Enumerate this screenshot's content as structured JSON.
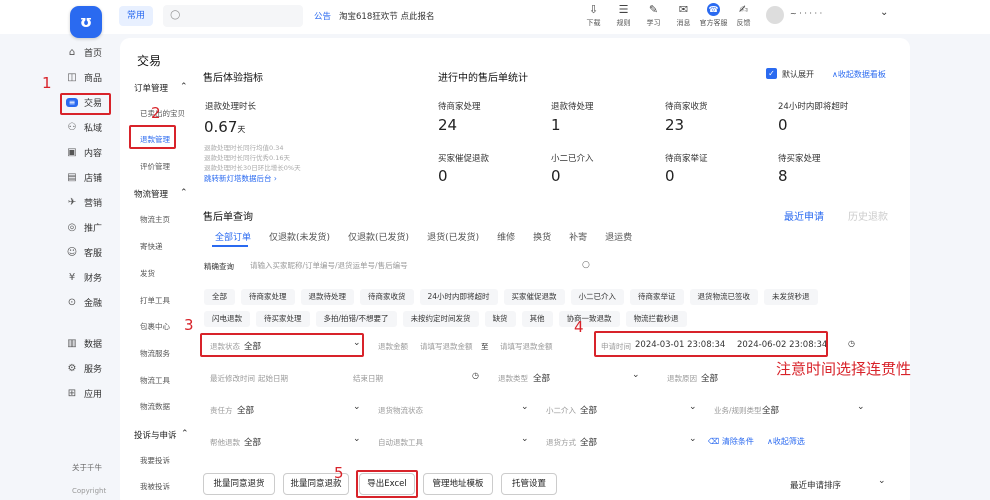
{
  "topbar": {
    "logo": "ʊ",
    "freq": "常用",
    "notice_tag": "公告",
    "notice_text": "淘宝618狂欢节 点此报名",
    "tools": [
      {
        "icon": "⇩",
        "label": "下载"
      },
      {
        "icon": "☰",
        "label": "规则"
      },
      {
        "icon": "✎",
        "label": "学习"
      },
      {
        "icon": "✉",
        "label": "消息"
      },
      {
        "icon": "☎",
        "label": "官方客服"
      },
      {
        "icon": "✍",
        "label": "反馈"
      }
    ],
    "user": "~ ·  · ·  ·  ·"
  },
  "nav": [
    {
      "icon": "⌂",
      "label": "首页"
    },
    {
      "icon": "◫",
      "label": "商品"
    },
    {
      "icon": "≡",
      "label": "交易"
    },
    {
      "icon": "⚇",
      "label": "私域"
    },
    {
      "icon": "▣",
      "label": "内容"
    },
    {
      "icon": "▤",
      "label": "店铺"
    },
    {
      "icon": "✈",
      "label": "营销"
    },
    {
      "icon": "◎",
      "label": "推广"
    },
    {
      "icon": "☺",
      "label": "客服"
    },
    {
      "icon": "¥",
      "label": "财务"
    },
    {
      "icon": "⊙",
      "label": "金融"
    },
    {
      "icon": "▥",
      "label": "数据"
    },
    {
      "icon": "⚙",
      "label": "服务"
    },
    {
      "icon": "⊞",
      "label": "应用"
    }
  ],
  "nav_footer": {
    "about": "关于千牛",
    "copyright": "Copyright"
  },
  "sub": {
    "title": "交易",
    "groups": [
      "订单管理",
      "物流管理",
      "投诉与申诉"
    ],
    "order_items": [
      "已卖出的宝贝",
      "退款管理",
      "评价管理"
    ],
    "logistics_items": [
      "物流主页",
      "寄快递",
      "发货",
      "打单工具",
      "包裹中心",
      "物流服务",
      "物流工具",
      "物流数据"
    ],
    "complaint_items": [
      "我要投诉",
      "我被投诉"
    ]
  },
  "annotations": {
    "n1": "1",
    "n2": "2",
    "n3": "3",
    "n4": "4",
    "n5": "5",
    "note": "注意时间选择连贯性"
  },
  "metrics": {
    "title": "售后体验指标",
    "refund_label": "退款处理时长",
    "refund_value": "0.67",
    "refund_unit": "天",
    "notes": [
      "退款处理时长同行均值0.34",
      "退款处理时长同行优秀0.16天",
      "退款处理时长30日环比增长0%天"
    ],
    "link": "跳转新灯塔数据后台 ›"
  },
  "stats": {
    "title": "进行中的售后单统计",
    "default_expand": "默认展开",
    "collapse": "∧收起数据看板",
    "items": [
      {
        "label": "待商家处理",
        "value": "24"
      },
      {
        "label": "退款待处理",
        "value": "1"
      },
      {
        "label": "待商家收货",
        "value": "23"
      },
      {
        "label": "24小时内即将超时",
        "value": "0"
      },
      {
        "label": "买家催促退款",
        "value": "0"
      },
      {
        "label": "小二已介入",
        "value": "0"
      },
      {
        "label": "待商家举证",
        "value": "0"
      },
      {
        "label": "待买家处理",
        "value": "8"
      }
    ]
  },
  "query": {
    "title": "售后单查询",
    "recent": "最近申请",
    "history": "历史退款",
    "tabs": [
      "全部订单",
      "仅退款(未发货)",
      "仅退款(已发货)",
      "退货(已发货)",
      "维修",
      "换货",
      "补寄",
      "退运费"
    ],
    "precise_label": "精确查询",
    "precise_placeholder": "请输入买家昵称/订单编号/退货运单号/售后编号",
    "chips": [
      "全部",
      "待商家处理",
      "退款待处理",
      "待商家收货",
      "24小时内即将超时",
      "买家催促退款",
      "小二已介入",
      "待商家举证",
      "退货物流已签收",
      "未发货秒退",
      "闪电退款",
      "待买家处理",
      "多拍/拍错/不想要了",
      "未按约定时间发货",
      "缺货",
      "其他",
      "协商一致退款",
      "物流拦截秒退"
    ],
    "refund_status_label": "退款状态",
    "refund_status_value": "全部",
    "refund_amount_label": "退款金额",
    "amount_min": "请填写退款金额",
    "amount_sep": "至",
    "amount_max": "请填写退款金额",
    "apply_time_label": "申请时间",
    "apply_start": "2024-03-01 23:08:34",
    "apply_end": "2024-06-02 23:08:34",
    "modify_label": "最近修改时间",
    "start_date": "起始日期",
    "end_date": "结束日期",
    "refund_type_label": "退款类型",
    "refund_type_value": "全部",
    "refund_reason_label": "退款原因",
    "refund_reason_value": "全部",
    "resp_label": "责任方",
    "resp_value": "全部",
    "logistics_label": "退货物流状态",
    "xiaoer_label": "小二介入",
    "xiaoer_value": "全部",
    "business_label": "业务/规则类型",
    "business_value": "全部",
    "help_label": "帮他退款",
    "help_value": "全部",
    "auto_tool_label": "自动退款工具",
    "return_method_label": "退货方式",
    "return_method_value": "全部",
    "clear": "清除条件",
    "collapse_filter": "∧收起筛选"
  },
  "actions": {
    "batch_agree_refund": "批量同意退货",
    "batch_agree_return": "批量同意退款",
    "export": "导出Excel",
    "address": "管理地址模板",
    "custody": "托管设置",
    "sort": "最近申请排序"
  }
}
